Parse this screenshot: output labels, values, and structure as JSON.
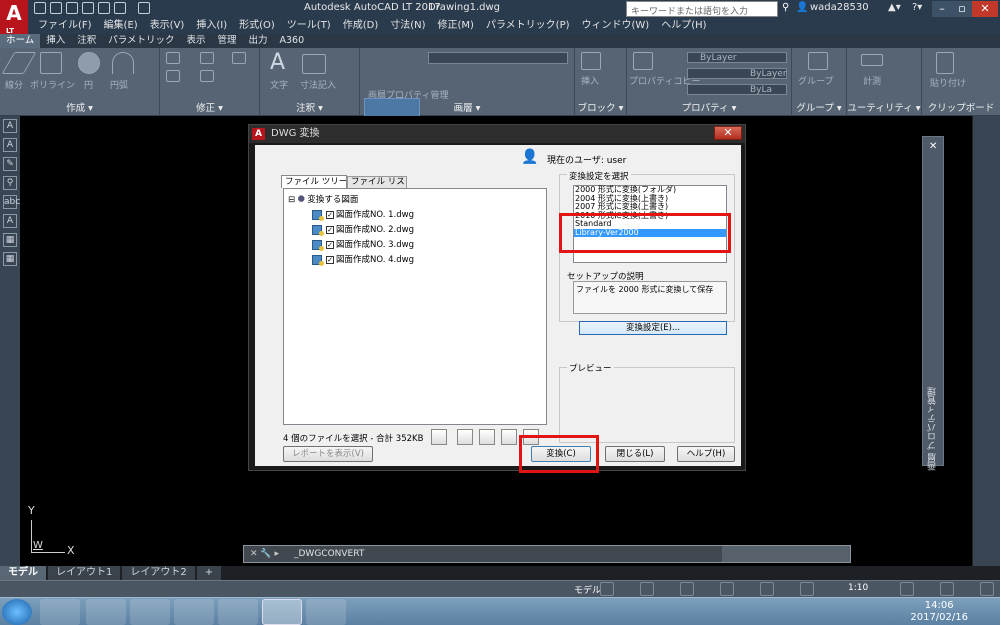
{
  "app": {
    "logo_text": "A",
    "logo_sub": "LT",
    "title": "Autodesk AutoCAD LT 2017",
    "doc": "Drawing1.dwg",
    "search_placeholder": "キーワードまたは語句を入力",
    "user": "wada28530"
  },
  "menu": [
    "ファイル(F)",
    "編集(E)",
    "表示(V)",
    "挿入(I)",
    "形式(O)",
    "ツール(T)",
    "作成(D)",
    "寸法(N)",
    "修正(M)",
    "パラメトリック(P)",
    "ウィンドウ(W)",
    "ヘルプ(H)"
  ],
  "ribbon_tabs": [
    "ホーム",
    "挿入",
    "注釈",
    "パラメトリック",
    "表示",
    "管理",
    "出力",
    "A360"
  ],
  "ribbon_panels": [
    "作成 ▾",
    "修正 ▾",
    "注釈 ▾",
    "画層 ▾",
    "ブロック ▾",
    "プロパティ ▾",
    "グループ ▾",
    "ユーティリティ ▾",
    "クリップボード"
  ],
  "ribbon_labels": {
    "line": "線分",
    "polyline": "ポリライン",
    "circle": "円",
    "arc": "円弧",
    "text": "文字",
    "dim": "寸法記入",
    "layer_props": "画層プロパティ管理",
    "insert": "挿入",
    "props": "プロパティコピー",
    "group": "グループ",
    "measure": "計測",
    "paste": "貼り付け",
    "bylayer1": "ByLayer",
    "bylayer2": "ByLayer",
    "bylayer3": "ByLa"
  },
  "dialog": {
    "title": "DWG 変換",
    "current_user": "現在のユーザ: user",
    "tab_tree": "ファイル ツリー(F)",
    "tab_list": "ファイル リスト(B)",
    "tree_root": "変換する図面",
    "files": [
      "図面作成NO. 1.dwg",
      "図面作成NO. 2.dwg",
      "図面作成NO. 3.dwg",
      "図面作成NO. 4.dwg"
    ],
    "summary": "4 個のファイルを選択 - 合計 352KB",
    "group_select": "変換設定を選択",
    "settings": [
      "2000 形式に変換(フォルダ)",
      "2004 形式に変換(上書き)",
      "2007 形式に変換(上書き)",
      "2010 形式に変換(上書き)",
      "Standard",
      "Library-Ver2000"
    ],
    "selected_setting": "Library-Ver2000",
    "desc_label": "セットアップの説明",
    "desc": "ファイルを 2000 形式に変換して保存",
    "settings_button": "変換設定(E)...",
    "preview_label": "プレビュー",
    "report_button": "レポートを表示(V)",
    "convert_button": "変換(C)",
    "close_button": "閉じる(L)",
    "help_button": "ヘルプ(H)"
  },
  "command_line": "_DWGCONVERT",
  "palette_title": "画層 プロパティ管理",
  "ucs": {
    "x": "X",
    "y": "Y",
    "w": "W"
  },
  "layout_tabs": [
    "モデル",
    "レイアウト1",
    "レイアウト2",
    "+"
  ],
  "status": {
    "model": "モデル",
    "scale": "1:10"
  },
  "taskbar": {
    "time": "14:06",
    "date": "2017/02/16"
  },
  "colors": {
    "accent_red": "#e31414",
    "autocad_red": "#b8141b",
    "selection": "#3399ff"
  }
}
